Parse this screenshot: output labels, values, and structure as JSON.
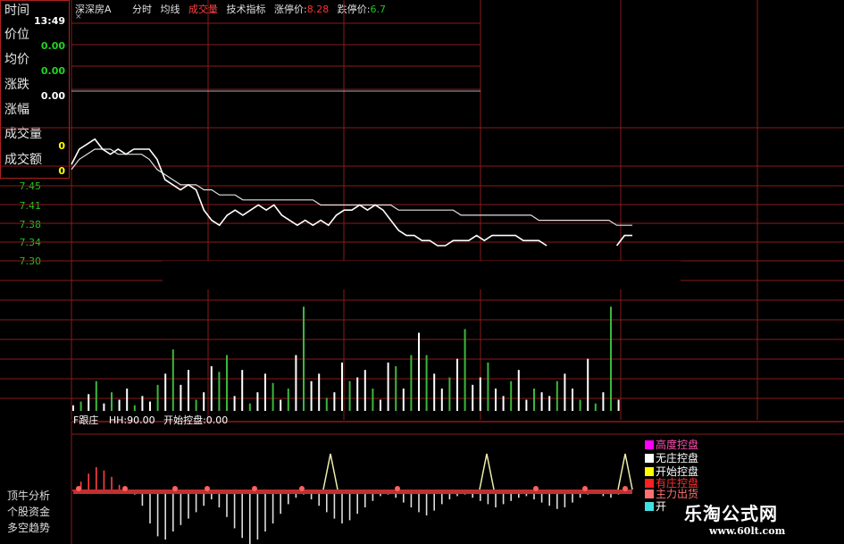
{
  "topbar": {
    "stock_name": "深深房A",
    "menu_fenshi": "分时",
    "menu_junxian": "均线",
    "menu_chengjiao": "成交量",
    "menu_jishu": "技术指标",
    "zhangting_label": "涨停价:",
    "zhangting_value": "8.28",
    "dieting_label": "跌停价:",
    "dieting_value": "6.7",
    "close_glyph": "×"
  },
  "info": {
    "time_label": "时间",
    "time_value": "13:49",
    "price_label": "价位",
    "price_value": "0.00",
    "avg_label": "均价",
    "avg_value": "0.00",
    "change_label": "涨跌",
    "change_value": "0.00",
    "pct_label": "涨幅",
    "vol_label": "成交量",
    "vol_value": "0",
    "amount_label": "成交额",
    "amount_value": "0"
  },
  "price_axis": [
    "7.45",
    "7.41",
    "7.38",
    "7.34",
    "7.30"
  ],
  "indicator": {
    "name": "F跟庄",
    "hh": "HH:90.00",
    "kaishi": "开始控盘:0.00"
  },
  "side_labels": [
    "顶牛分析",
    "个股资金",
    "多空趋势"
  ],
  "legend": [
    {
      "label": "高度控盘",
      "color": "#ff00ff"
    },
    {
      "label": "无庄控盘",
      "color": "#ffffff"
    },
    {
      "label": "开始控盘",
      "color": "#ffff00"
    },
    {
      "label": "有庄控盘",
      "color": "#ff2020"
    },
    {
      "label": "主力出货",
      "color": "#ff7070"
    },
    {
      "label": "开",
      "color": "#40e0e0"
    }
  ],
  "watermark": {
    "title": "乐淘公式网",
    "url": "www.60lt.com"
  },
  "colors": {
    "grid": "#8a1a1a",
    "up": "#ffffff",
    "down": "#3cb83c",
    "accent_red": "#ff3030"
  },
  "chart_data": {
    "type": "line",
    "title": "",
    "xlabel": "",
    "ylabel": "",
    "ylim": [
      7.28,
      7.53
    ],
    "series": [
      {
        "name": "",
        "kind": "price",
        "values": [
          7.47,
          7.5,
          7.51,
          7.52,
          7.5,
          7.49,
          7.5,
          7.49,
          7.5,
          7.5,
          7.5,
          7.48,
          7.44,
          7.43,
          7.42,
          7.43,
          7.42,
          7.38,
          7.36,
          7.35,
          7.37,
          7.38,
          7.37,
          7.38,
          7.39,
          7.38,
          7.39,
          7.37,
          7.36,
          7.35,
          7.36,
          7.35,
          7.36,
          7.35,
          7.37,
          7.38,
          7.38,
          7.39,
          7.38,
          7.39,
          7.38,
          7.36,
          7.34,
          7.33,
          7.33,
          7.32,
          7.32,
          7.31,
          7.31,
          7.32,
          7.32,
          7.32,
          7.33,
          7.32,
          7.33,
          7.33,
          7.33,
          7.33,
          7.32,
          7.32,
          7.32,
          7.31,
          null,
          null,
          null,
          null,
          null,
          null,
          null,
          null,
          7.31,
          7.33,
          7.33
        ]
      },
      {
        "name": "",
        "kind": "avg",
        "values": [
          7.46,
          7.48,
          7.49,
          7.5,
          7.5,
          7.5,
          7.49,
          7.49,
          7.49,
          7.49,
          7.48,
          7.46,
          7.45,
          7.44,
          7.43,
          7.43,
          7.43,
          7.42,
          7.42,
          7.41,
          7.41,
          7.41,
          7.4,
          7.4,
          7.4,
          7.4,
          7.4,
          7.4,
          7.4,
          7.4,
          7.4,
          7.4,
          7.39,
          7.39,
          7.39,
          7.39,
          7.39,
          7.39,
          7.39,
          7.39,
          7.39,
          7.39,
          7.38,
          7.38,
          7.38,
          7.38,
          7.38,
          7.38,
          7.38,
          7.38,
          7.37,
          7.37,
          7.37,
          7.37,
          7.37,
          7.37,
          7.37,
          7.37,
          7.37,
          7.37,
          7.36,
          7.36,
          7.36,
          7.36,
          7.36,
          7.36,
          7.36,
          7.36,
          7.36,
          7.36,
          7.35,
          7.35,
          7.35
        ]
      }
    ],
    "volume": {
      "values": [
        3,
        5,
        9,
        16,
        4,
        10,
        6,
        12,
        3,
        8,
        5,
        14,
        20,
        33,
        14,
        22,
        6,
        10,
        24,
        21,
        30,
        8,
        22,
        4,
        10,
        20,
        15,
        6,
        12,
        30,
        56,
        16,
        20,
        7,
        10,
        26,
        16,
        18,
        22,
        12,
        6,
        26,
        24,
        12,
        30,
        42,
        30,
        20,
        12,
        18,
        28,
        44,
        14,
        18,
        26,
        12,
        8,
        16,
        22,
        6,
        12,
        10,
        8,
        16,
        20,
        12,
        6,
        28,
        4,
        10,
        56,
        6
      ],
      "up": [
        1,
        0,
        1,
        0,
        1,
        0,
        1,
        1,
        0,
        1,
        1,
        0,
        1,
        0,
        1,
        1,
        0,
        1,
        1,
        0,
        0,
        1,
        1,
        0,
        1,
        1,
        0,
        1,
        0,
        1,
        0,
        1,
        1,
        0,
        1,
        1,
        0,
        1,
        1,
        0,
        1,
        1,
        0,
        1,
        0,
        1,
        0,
        1,
        1,
        0,
        1,
        0,
        1,
        1,
        0,
        1,
        1,
        0,
        1,
        1,
        0,
        1,
        1,
        0,
        1,
        1,
        0,
        1,
        0,
        1,
        0,
        1
      ]
    },
    "indicator_osc": {
      "values": [
        2,
        12,
        22,
        30,
        26,
        18,
        8,
        2,
        -4,
        -18,
        -40,
        -56,
        -60,
        -50,
        -42,
        -34,
        -26,
        -18,
        -10,
        -20,
        -32,
        -46,
        -58,
        -66,
        -60,
        -50,
        -40,
        -28,
        -16,
        -8,
        -4,
        -10,
        -18,
        -26,
        -34,
        -40,
        -36,
        -28,
        -20,
        -12,
        -6,
        -4,
        -8,
        -14,
        -20,
        -26,
        -30,
        -24,
        -16,
        -10,
        -6,
        -4,
        -8,
        -12,
        -16,
        -20,
        -16,
        -12,
        -8,
        -6,
        -10,
        -14,
        -18,
        -22,
        -20,
        -14,
        -8,
        -4,
        -2,
        -6,
        -8,
        -4
      ]
    }
  }
}
